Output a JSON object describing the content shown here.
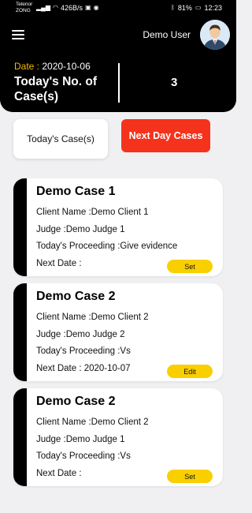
{
  "status_bar": {
    "carrier_1": "Telenor",
    "carrier_2": "ZONG",
    "network": "4G",
    "data_speed": "426B/s",
    "battery": "81%",
    "time": "12:23"
  },
  "header": {
    "user_name": "Demo User",
    "date_label": "Date :",
    "date_value": "2020-10-06",
    "count_title": "Today's No. of Case(s)",
    "count_value": "3"
  },
  "tabs": {
    "today_label": "Today's Case(s)",
    "next_day_label": "Next Day Cases"
  },
  "cases": [
    {
      "title": "Demo Case 1",
      "client": "Client Name :Demo Client 1",
      "judge": "Judge :Demo Judge 1",
      "proceeding": "Today's Proceeding :Give evidence",
      "next_date": "Next Date :",
      "action": "Set"
    },
    {
      "title": "Demo Case 2",
      "client": "Client Name :Demo Client 2",
      "judge": "Judge :Demo Judge 2",
      "proceeding": "Today's Proceeding :Vs",
      "next_date": "Next Date : 2020-10-07",
      "action": "Edit"
    },
    {
      "title": "Demo Case 2",
      "client": "Client Name :Demo Client 2",
      "judge": "Judge :Demo Judge 1",
      "proceeding": "Today's Proceeding :Vs",
      "next_date": "Next Date :",
      "action": "Set"
    }
  ],
  "colors": {
    "accent_red": "#f5331c",
    "action_yellow": "#f9cf00",
    "date_label": "#f5b800"
  }
}
